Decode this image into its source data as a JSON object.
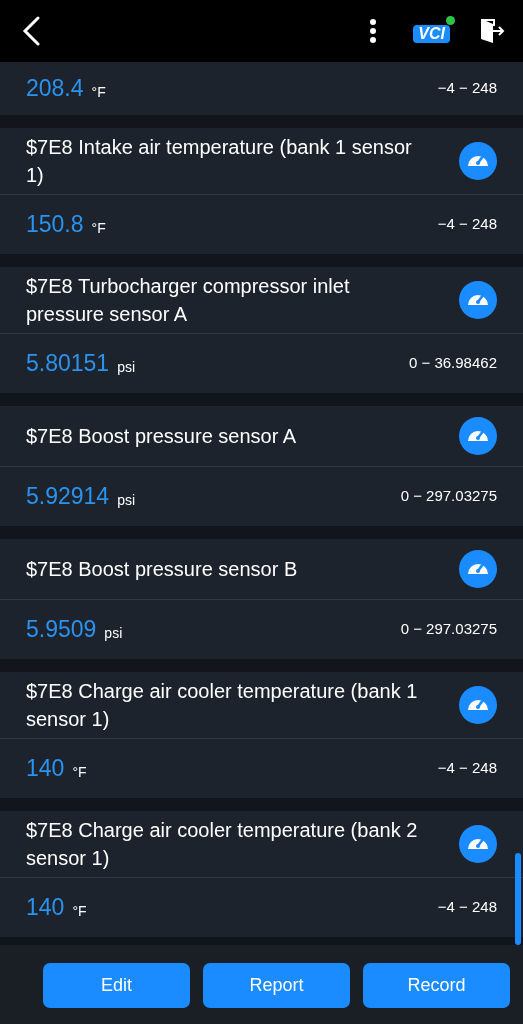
{
  "header": {
    "logo_text": "VCI"
  },
  "items": [
    {
      "value": "208.4",
      "unit": "°F",
      "range": "−4 − 248"
    },
    {
      "title": "$7E8 Intake air temperature (bank 1 sensor 1)",
      "value": "150.8",
      "unit": "°F",
      "range": "−4 − 248"
    },
    {
      "title": "$7E8 Turbocharger compressor inlet pressure sensor A",
      "value": "5.80151",
      "unit": "psi",
      "range": "0 − 36.98462"
    },
    {
      "title": "$7E8 Boost pressure sensor A",
      "value": "5.92914",
      "unit": "psi",
      "range": "0 − 297.03275"
    },
    {
      "title": "$7E8 Boost pressure sensor B",
      "value": "5.9509",
      "unit": "psi",
      "range": "0 − 297.03275"
    },
    {
      "title": "$7E8 Charge air cooler temperature (bank 1 sensor 1)",
      "value": "140",
      "unit": "°F",
      "range": "−4 − 248"
    },
    {
      "title": "$7E8 Charge air cooler temperature (bank 2 sensor 1)",
      "value": "140",
      "unit": "°F",
      "range": "−4 − 248"
    }
  ],
  "buttons": [
    "Edit",
    "Report",
    "Record"
  ]
}
